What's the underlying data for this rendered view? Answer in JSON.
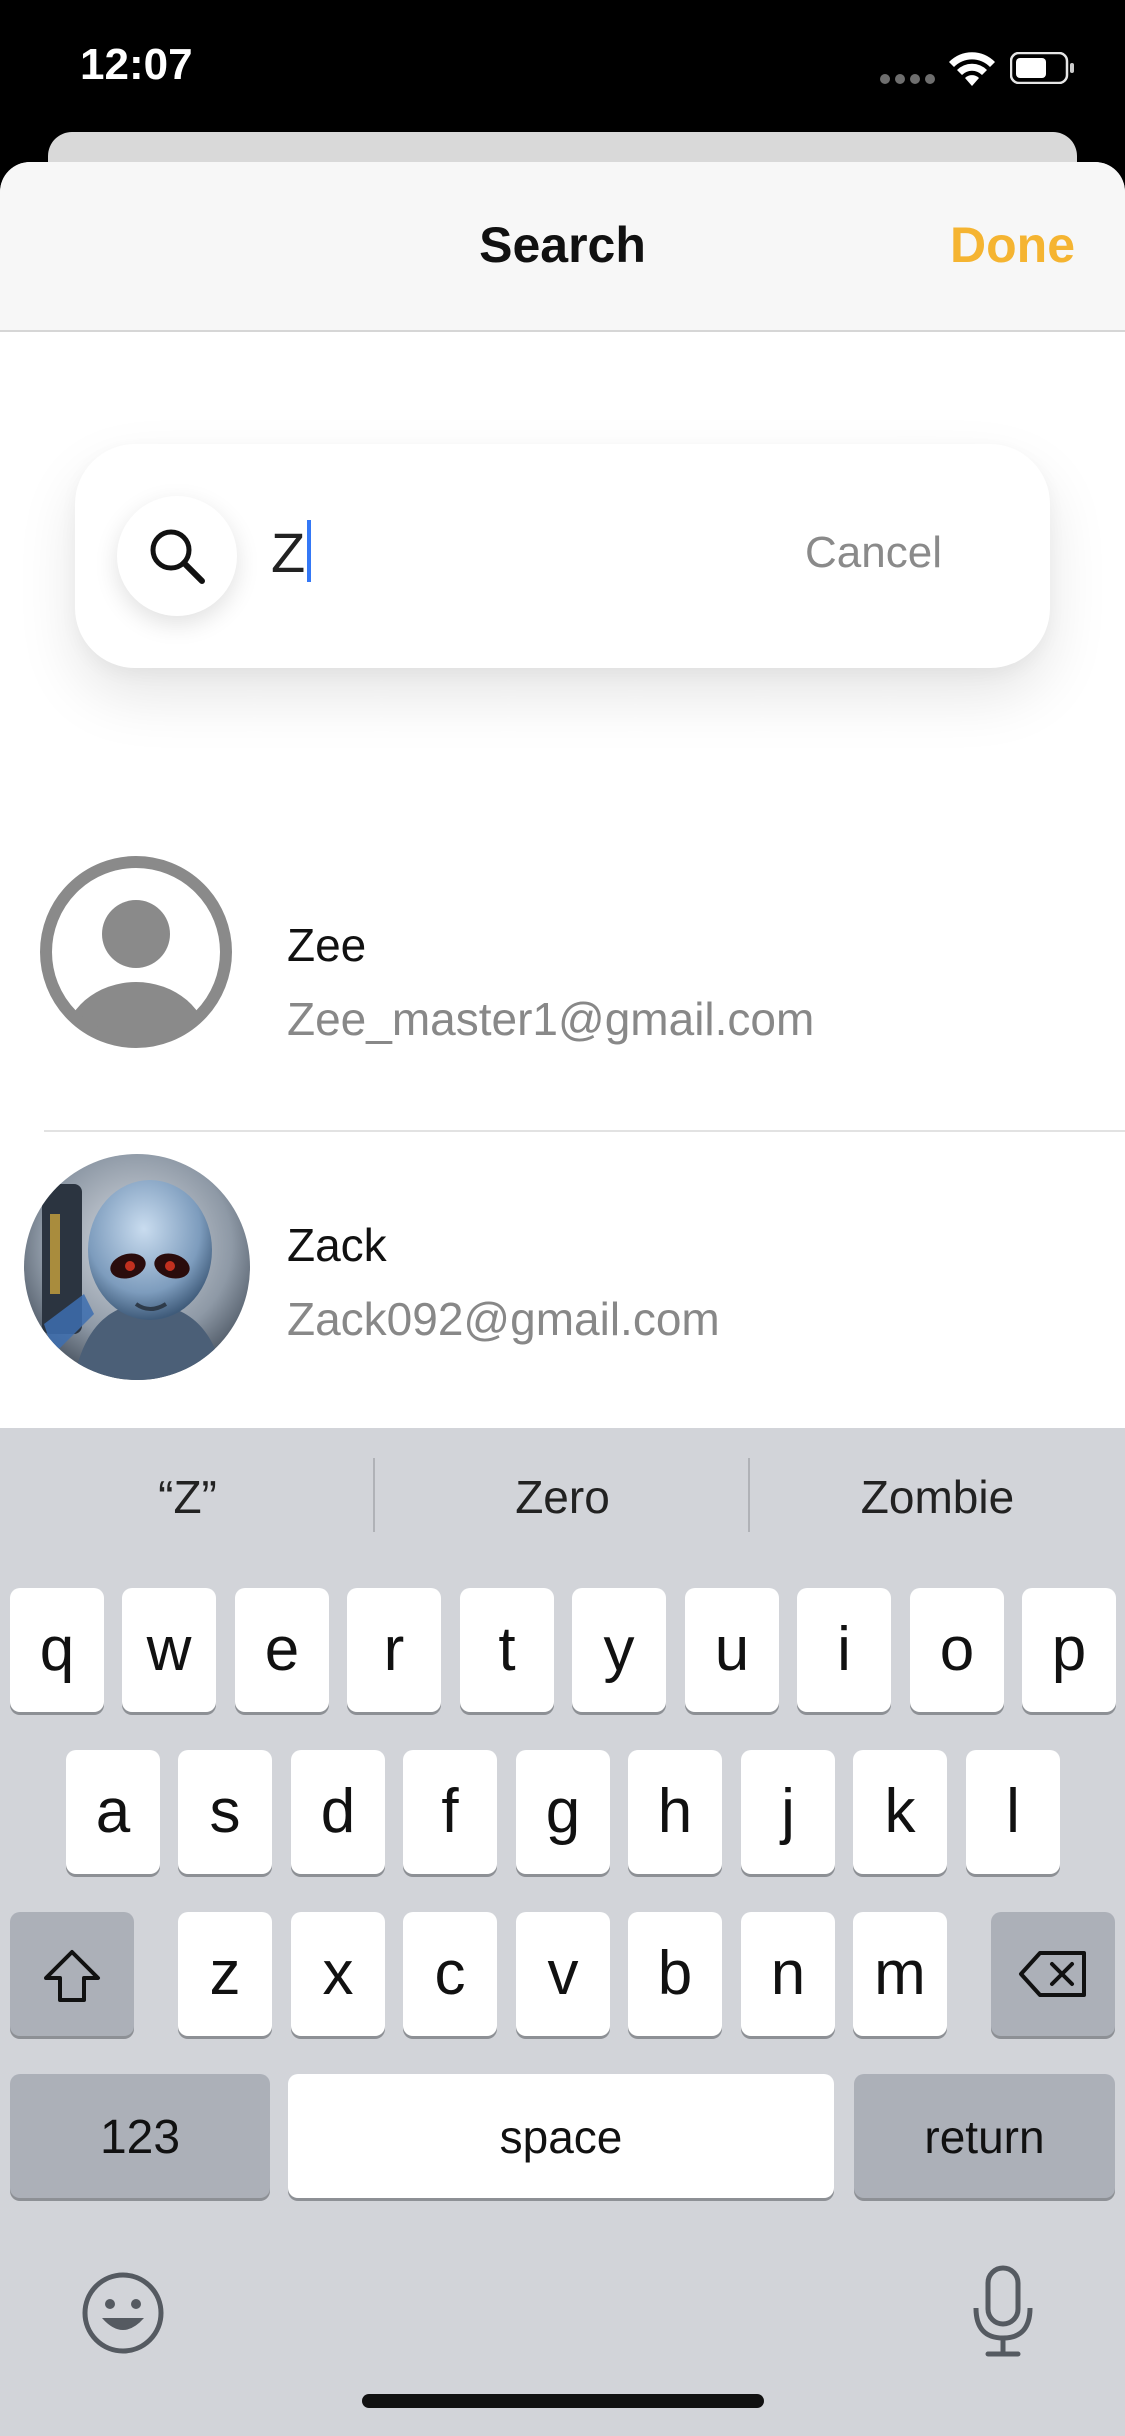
{
  "status_bar": {
    "time": "12:07"
  },
  "sheet": {
    "title": "Search",
    "done_label": "Done"
  },
  "search": {
    "value": "Z",
    "cancel_label": "Cancel"
  },
  "results": [
    {
      "name": "Zee",
      "email": "Zee_master1@gmail.com",
      "avatar": "default-person-icon"
    },
    {
      "name": "Zack",
      "email": "Zack092@gmail.com",
      "avatar": "alien-avatar-photo"
    }
  ],
  "keyboard": {
    "suggestions": [
      "“Z”",
      "Zero",
      "Zombie"
    ],
    "row1": [
      "q",
      "w",
      "e",
      "r",
      "t",
      "y",
      "u",
      "i",
      "o",
      "p"
    ],
    "row2": [
      "a",
      "s",
      "d",
      "f",
      "g",
      "h",
      "j",
      "k",
      "l"
    ],
    "row3": [
      "z",
      "x",
      "c",
      "v",
      "b",
      "n",
      "m"
    ],
    "numbers_label": "123",
    "space_label": "space",
    "return_label": "return"
  },
  "colors": {
    "accent": "#f5b431",
    "caret": "#3478f6"
  }
}
